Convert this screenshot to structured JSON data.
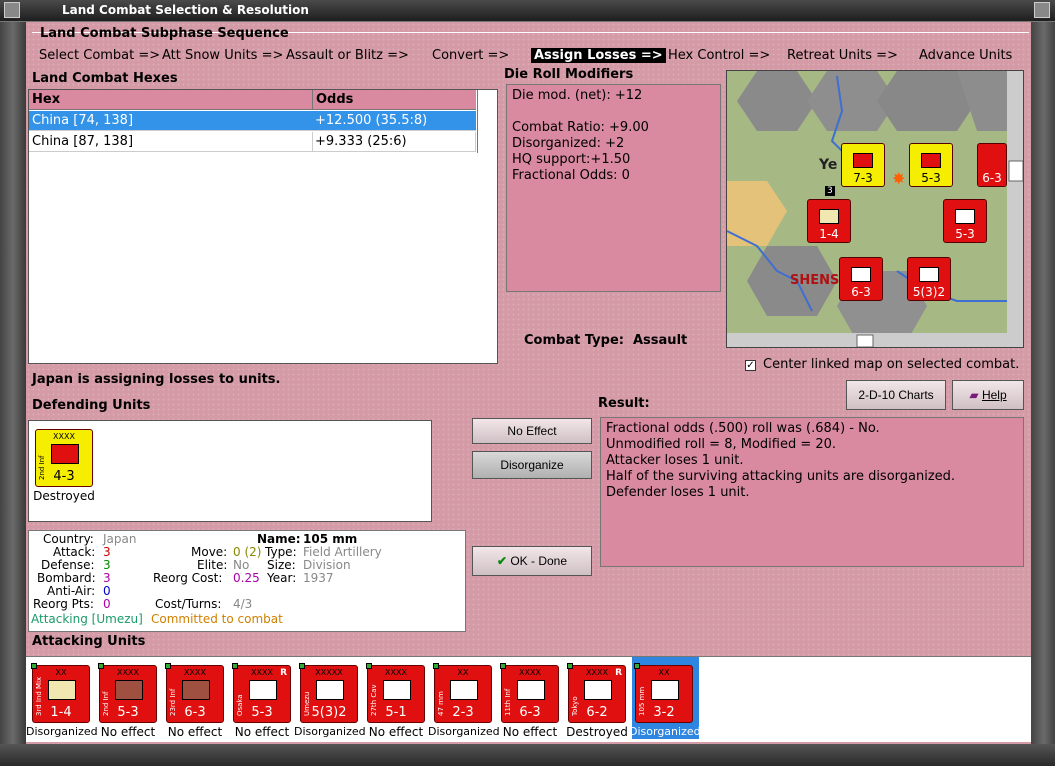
{
  "window": {
    "title": "Land Combat Selection & Resolution"
  },
  "sequence": {
    "title": "Land Combat Subphase Sequence",
    "steps": [
      "Select Combat =>",
      "Att Snow Units =>",
      "Assault or Blitz =>",
      "Convert =>",
      "Assign Losses =>",
      "Hex Control =>",
      "Retreat Units =>",
      "Advance Units"
    ],
    "active_index": 4
  },
  "hexes": {
    "title": "Land Combat Hexes",
    "col_hex": "Hex",
    "col_odds": "Odds",
    "rows": [
      {
        "hex": "China [74, 138]",
        "odds": "+12.500 (35.5:8)"
      },
      {
        "hex": "China [87, 138]",
        "odds": "+9.333 (25:6)"
      }
    ]
  },
  "die_roll": {
    "title": "Die Roll Modifiers",
    "lines": [
      "Die mod. (net): +12",
      "",
      "Combat Ratio: +9.00",
      "Disorganized: +2",
      "HQ support:+1.50",
      "Fractional Odds: 0"
    ]
  },
  "combat_type": {
    "label": "Combat Type:",
    "value": "Assault"
  },
  "center_map": {
    "label": "Center linked map on selected combat.",
    "checked": true
  },
  "buttons": {
    "charts": "2-D-10 Charts",
    "help": "Help",
    "no_effect": "No Effect",
    "disorganize": "Disorganize",
    "ok_done": "OK - Done"
  },
  "status": "Japan is assigning losses to units.",
  "defending": {
    "title": "Defending Units",
    "units": [
      {
        "name": "2nd Inf",
        "size": "XXXX",
        "values": "4-3",
        "color": "#f5ee00",
        "status": "Destroyed"
      }
    ]
  },
  "result": {
    "title": "Result:",
    "lines": [
      "Fractional odds (.500) roll was (.684)  - No.",
      "Unmodified roll = 8, Modified = 20.",
      "Attacker loses 1 unit.",
      "Half of the surviving attacking units are disorganized.",
      "Defender loses 1 unit."
    ]
  },
  "unit_info": {
    "country_label": "Country:",
    "country": "Japan",
    "attack_label": "Attack:",
    "attack": "3",
    "defense_label": "Defense:",
    "defense": "3",
    "bombard_label": "Bombard:",
    "bombard": "3",
    "antiair_label": "Anti-Air:",
    "antiair": "0",
    "reorgpts_label": "Reorg Pts:",
    "reorgpts": "0",
    "name_label": "Name:",
    "name": "105 mm",
    "move_label": "Move:",
    "move": "0 (2)",
    "elite_label": "Elite:",
    "elite": "No",
    "reorgcost_label": "Reorg Cost:",
    "reorgcost": "0.25",
    "costturns_label": "Cost/Turns:",
    "costturns": "4/3",
    "type_label": "Type:",
    "type": "Field Artillery",
    "size_label": "Size:",
    "size": "Division",
    "year_label": "Year:",
    "year": "1937",
    "attacking": "Attacking [Umezu]",
    "committed": "Committed to combat"
  },
  "attacking": {
    "title": "Attacking Units",
    "units": [
      {
        "name": "3rd Ind Mix",
        "size": "XX",
        "values": "1-4",
        "status": "Disorganized",
        "sym": "#f0e8b0",
        "r": ""
      },
      {
        "name": "2nd Inf",
        "size": "XXXX",
        "values": "5-3",
        "status": "No effect",
        "sym": "#a05040",
        "r": ""
      },
      {
        "name": "23rd Inf",
        "size": "XXXX",
        "values": "6-3",
        "status": "No effect",
        "sym": "#a05040",
        "r": ""
      },
      {
        "name": "Osaka",
        "size": "XXXX",
        "values": "5-3",
        "status": "No effect",
        "sym": "#ffffff",
        "r": "R"
      },
      {
        "name": "Umezu",
        "size": "XXXXX",
        "values": "5(3)2",
        "status": "Disorganized",
        "sym": "#ffffff",
        "r": ""
      },
      {
        "name": "27th Cav",
        "size": "XXXX",
        "values": "5-1",
        "status": "No effect",
        "sym": "#ffffff",
        "r": ""
      },
      {
        "name": "47 mm",
        "size": "XX",
        "values": "2-3",
        "status": "Disorganized",
        "sym": "#ffffff",
        "r": ""
      },
      {
        "name": "11th Inf",
        "size": "XXXX",
        "values": "6-3",
        "status": "No effect",
        "sym": "#ffffff",
        "r": ""
      },
      {
        "name": "Tokyo",
        "size": "XXXX",
        "values": "6-2",
        "status": "Destroyed",
        "sym": "#ffffff",
        "r": "R"
      },
      {
        "name": "105 mm",
        "size": "XX",
        "values": "3-2",
        "status": "Disorganized",
        "sym": "#ffffff",
        "r": ""
      }
    ]
  },
  "map": {
    "labels": [
      "Ye",
      "SHENS"
    ],
    "counters": [
      {
        "name": "10th Inf",
        "size": "XXXX",
        "values": "7-3",
        "color": "#f5ee00"
      },
      {
        "name": "2nd Inf",
        "size": "XXXX",
        "values": "5-3",
        "color": "#f5ee00"
      },
      {
        "name": "3rd Ind Mix",
        "size": "XX",
        "values": "1-4",
        "color": "#e01010"
      },
      {
        "name": "Osaka",
        "size": "XXXX",
        "values": "5-3",
        "color": "#e01010"
      },
      {
        "name": "11th Inf",
        "size": "XXXX",
        "values": "6-3",
        "color": "#e01010"
      },
      {
        "name": "Umezu",
        "size": "XXXXX",
        "values": "5(3)2",
        "color": "#e01010"
      },
      {
        "name": "6th Inf",
        "size": "XXXX",
        "values": "6-3",
        "color": "#e01010"
      }
    ],
    "stack_count": "3"
  },
  "colors": {
    "client_bg": "#d49aa6",
    "selected_row": "#3393e8",
    "unit_red": "#e01010",
    "unit_yellow": "#f5ee00"
  }
}
